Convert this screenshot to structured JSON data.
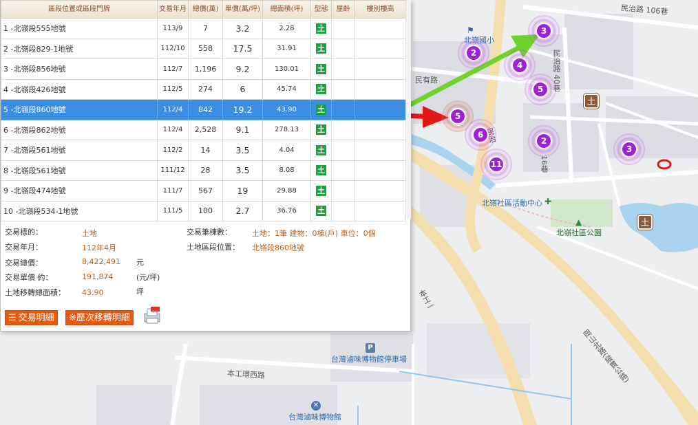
{
  "table": {
    "headers": {
      "address": "區段位置或區段門牌",
      "date": "交易年月",
      "total": "總價(萬)",
      "unit": "單價(萬/坪)",
      "area": "總面積(坪)",
      "type": "型態",
      "age": "屋齡",
      "floor": "樓別樓高"
    },
    "rows": [
      {
        "no": "1",
        "addr": "-北嶺段555地號",
        "date": "113/9",
        "total": "7",
        "unit": "3.2",
        "area": "2.28",
        "type": "土"
      },
      {
        "no": "2",
        "addr": "-北嶺段829-1地號",
        "date": "112/10",
        "total": "558",
        "unit": "17.5",
        "area": "31.91",
        "type": "土"
      },
      {
        "no": "3",
        "addr": "-北嶺段856地號",
        "date": "112/7",
        "total": "1,196",
        "unit": "9.2",
        "area": "130.01",
        "type": "土"
      },
      {
        "no": "4",
        "addr": "-北嶺段426地號",
        "date": "112/5",
        "total": "274",
        "unit": "6",
        "area": "45.74",
        "type": "土"
      },
      {
        "no": "5",
        "addr": "-北嶺段860地號",
        "date": "112/4",
        "total": "842",
        "unit": "19.2",
        "area": "43.90",
        "type": "土"
      },
      {
        "no": "6",
        "addr": "-北嶺段862地號",
        "date": "112/4",
        "total": "2,528",
        "unit": "9.1",
        "area": "278.13",
        "type": "土"
      },
      {
        "no": "7",
        "addr": "-北嶺段561地號",
        "date": "112/2",
        "total": "14",
        "unit": "3.5",
        "area": "4.04",
        "type": "土"
      },
      {
        "no": "8",
        "addr": "-北嶺段561地號",
        "date": "111/12",
        "total": "28",
        "unit": "3.5",
        "area": "8.08",
        "type": "土"
      },
      {
        "no": "9",
        "addr": "-北嶺段474地號",
        "date": "111/7",
        "total": "567",
        "unit": "19",
        "area": "29.88",
        "type": "土"
      },
      {
        "no": "10",
        "addr": "-北嶺段534-1地號",
        "date": "111/5",
        "total": "100",
        "unit": "2.7",
        "area": "36.76",
        "type": "土"
      }
    ],
    "selected_index": 4
  },
  "detail": {
    "target_label": "交易標的：",
    "target_value": "土地",
    "date_label": "交易年月：",
    "date_value": "112年4月",
    "total_label": "交易總價：",
    "total_value": "8,422,491",
    "total_unit": "元",
    "unit_label": "交易單價 約：",
    "unit_value": "191,874",
    "unit_unit": "(元/坪)",
    "area_label": "土地移轉總面積：",
    "area_value": "43.90",
    "area_unit": "坪",
    "count_label": "交易筆棟數：",
    "count_value": "土地：1筆 建物：0棟(戶) 車位：0個",
    "location_label": "土地區段位置：",
    "location_value": "北嶺段860地號"
  },
  "buttons": {
    "detail": "交易明細",
    "history": "※歷次移轉明細"
  },
  "map": {
    "labels": {
      "minzhi106": "民治路 106巷",
      "school": "北嶺國小",
      "minyou": "民有路",
      "minzhi40": "民治路 40巷",
      "min": "民治",
      "lane16": "16巷",
      "community_center": "北嶺社區活動中心",
      "community_park": "北嶺社區公園",
      "bengong1": "本工一",
      "gangshan": "岡山北路(縱貫公路)",
      "parking": "台灣滷味博物館停車場",
      "bengongring": "本工環西路",
      "museum": "台灣滷味博物館"
    },
    "clusters": [
      {
        "count": "3",
        "state": "normal"
      },
      {
        "count": "2",
        "state": "normal"
      },
      {
        "count": "4",
        "state": "normal"
      },
      {
        "count": "5",
        "state": "normal"
      },
      {
        "count": "5",
        "state": "active"
      },
      {
        "count": "6",
        "state": "normal"
      },
      {
        "count": "2",
        "state": "normal"
      },
      {
        "count": "11",
        "state": "normal"
      },
      {
        "count": "3",
        "state": "normal"
      }
    ],
    "poi_glyph": "土",
    "parking_glyph": "P",
    "colors": {
      "cluster": "#a020d8",
      "red_arrow": "#e01818",
      "green_arrow": "#6ed42a",
      "selected_row": "#3b8fe0",
      "detail_value": "#b8601a",
      "button": "#e65a10"
    }
  }
}
